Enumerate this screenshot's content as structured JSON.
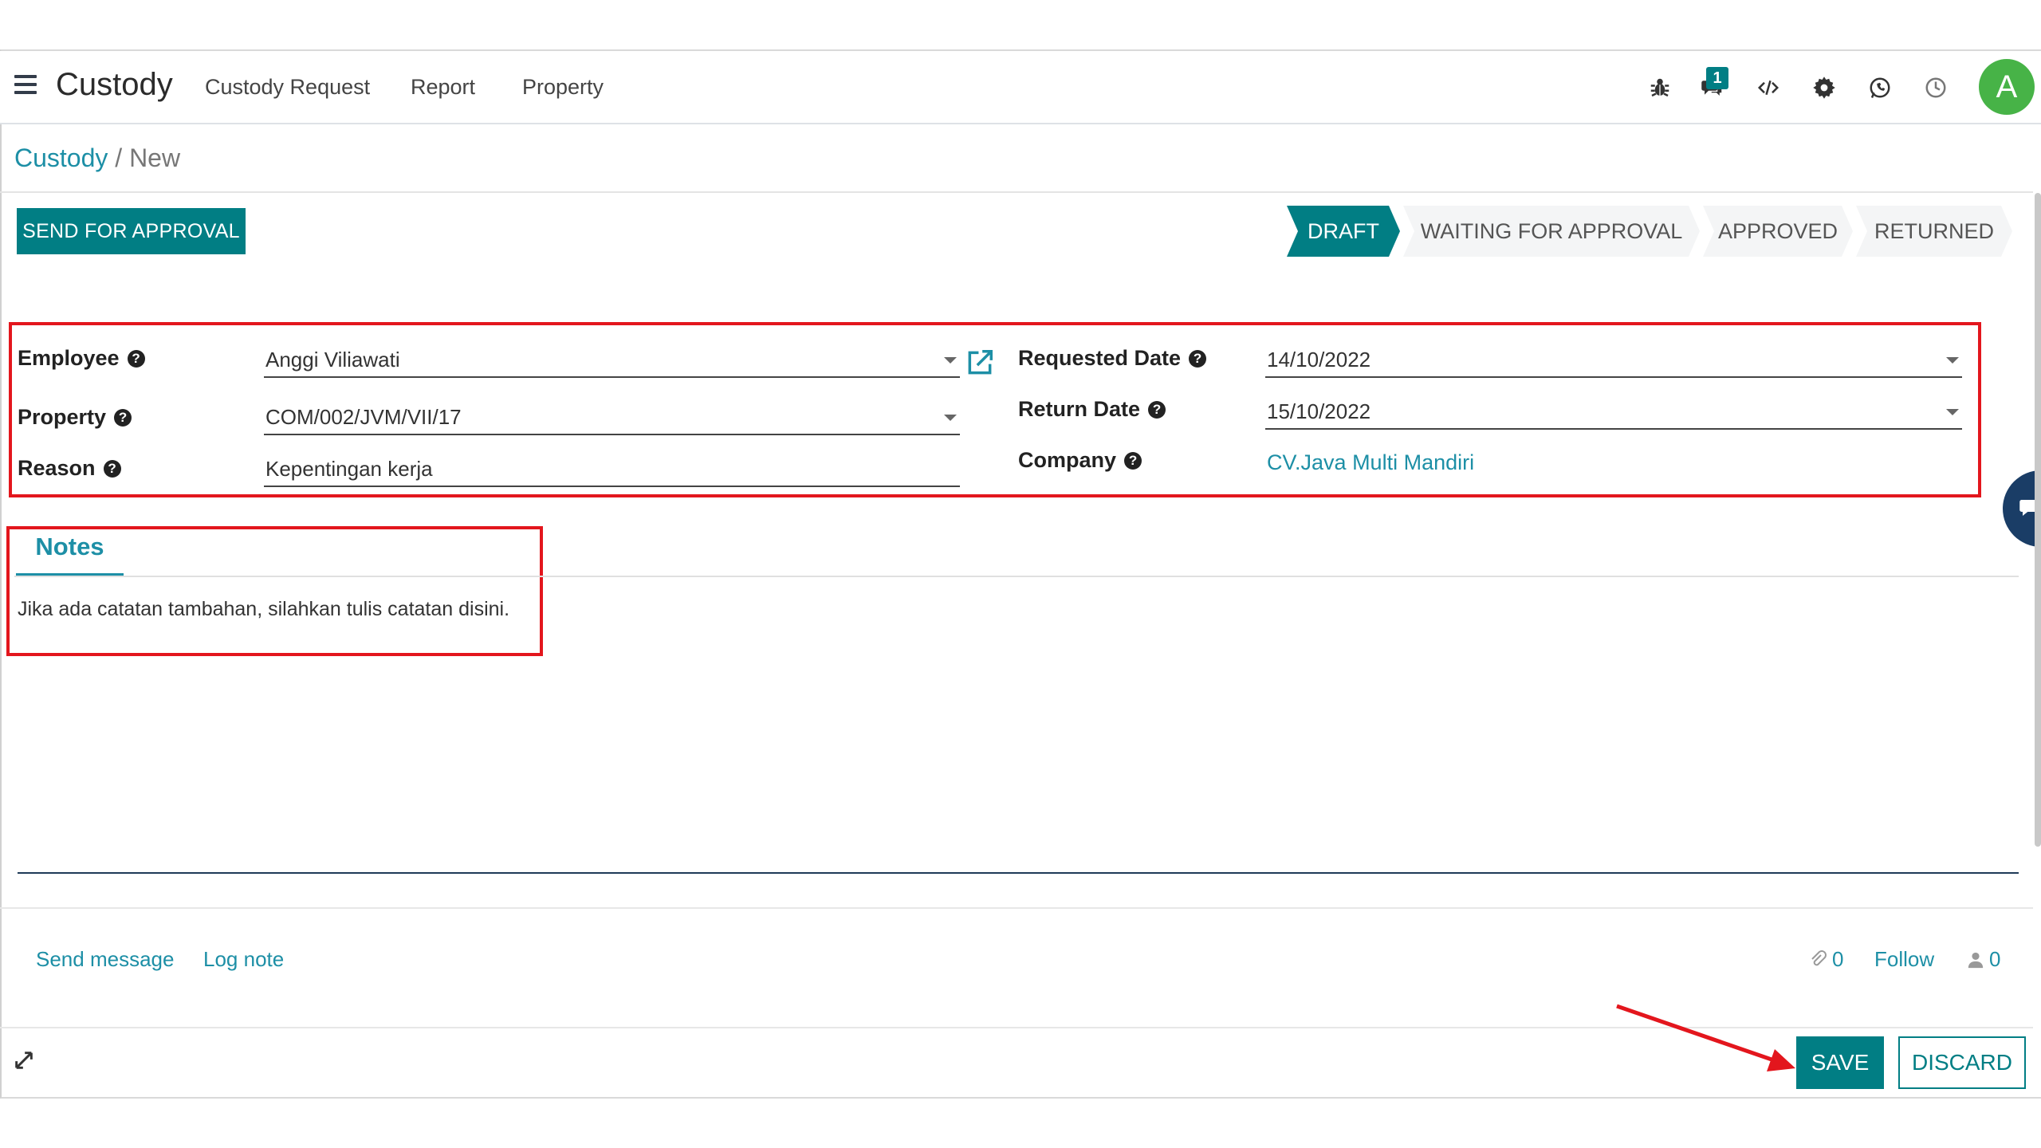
{
  "navbar": {
    "app_title": "Custody",
    "menu": [
      "Custody Request",
      "Report",
      "Property"
    ],
    "message_count": "1",
    "user_initial": "A",
    "icons": [
      "bug-icon",
      "chat-icon",
      "code-icon",
      "gear-icon",
      "whatsapp-icon",
      "clock-icon"
    ]
  },
  "breadcrumb": {
    "parent": "Custody",
    "separator": "/",
    "current": "New"
  },
  "statusbar": {
    "action_button": "SEND FOR APPROVAL",
    "stages": [
      "DRAFT",
      "WAITING FOR APPROVAL",
      "APPROVED",
      "RETURNED"
    ],
    "active_stage": "DRAFT"
  },
  "form": {
    "employee": {
      "label": "Employee",
      "value": "Anggi Viliawati"
    },
    "property": {
      "label": "Property",
      "value": "COM/002/JVM/VII/17"
    },
    "reason": {
      "label": "Reason",
      "value": "Kepentingan kerja"
    },
    "requested_date": {
      "label": "Requested Date",
      "value": "14/10/2022"
    },
    "return_date": {
      "label": "Return Date",
      "value": "15/10/2022"
    },
    "company": {
      "label": "Company",
      "value": "CV.Java Multi Mandiri"
    },
    "help_glyph": "?"
  },
  "notes": {
    "tab_label": "Notes",
    "text": "Jika ada catatan tambahan, silahkan tulis catatan disini."
  },
  "chatter": {
    "send_message": "Send message",
    "log_note": "Log note",
    "attachments": "0",
    "follow": "Follow",
    "followers": "0"
  },
  "footer": {
    "save": "SAVE",
    "discard": "DISCARD"
  },
  "colors": {
    "primary": "#017e84",
    "link": "#1d8fa6",
    "highlight": "#e3161d",
    "avatar": "#47b347"
  }
}
